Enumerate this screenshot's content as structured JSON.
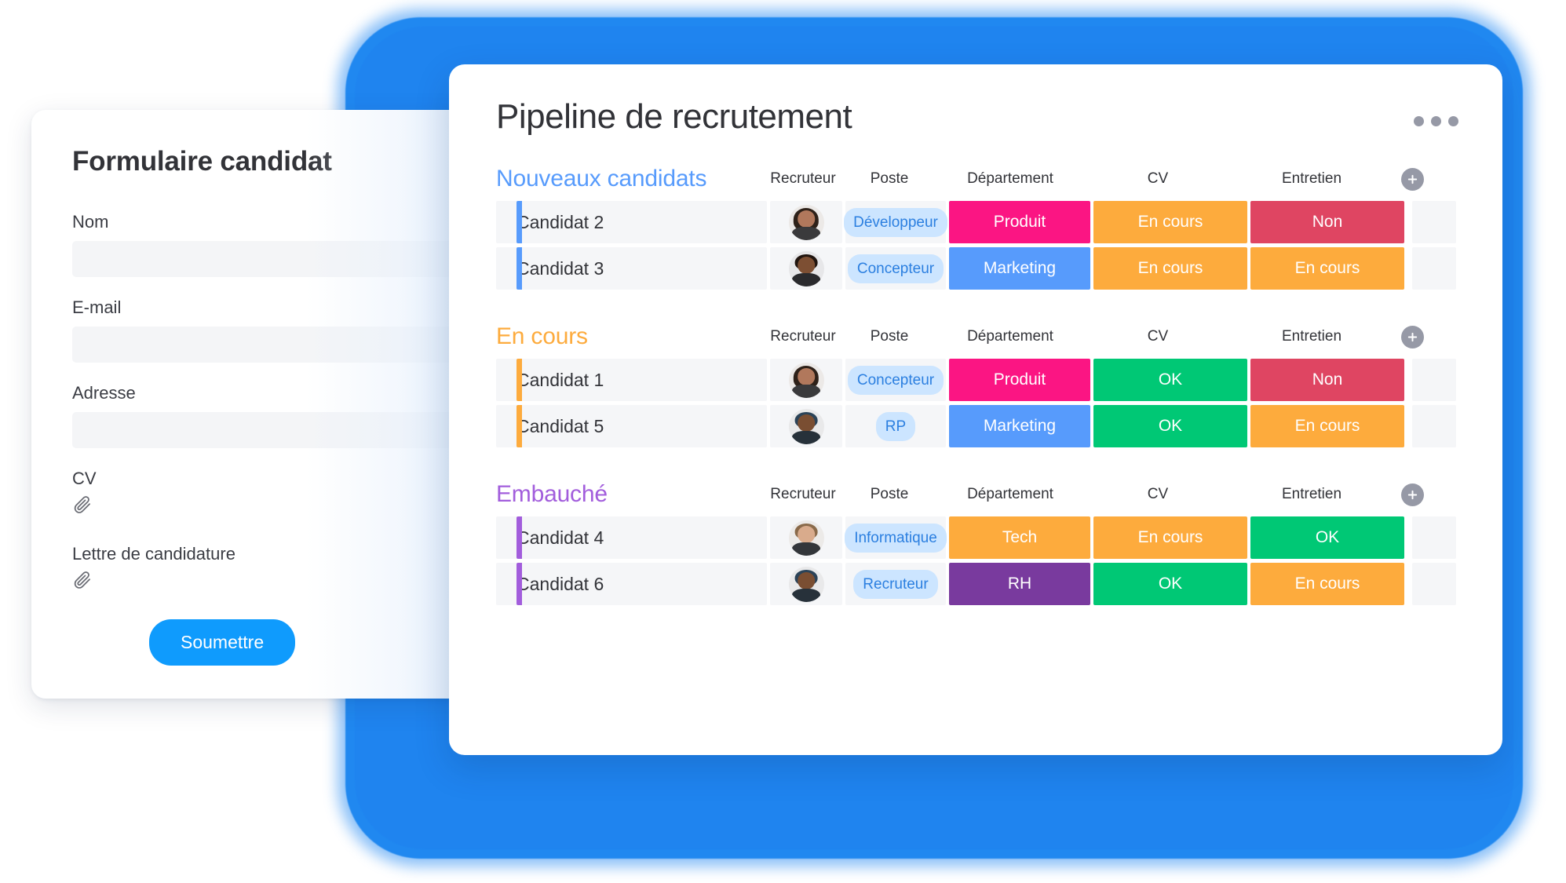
{
  "colors": {
    "glow_blue": "#2088f0",
    "accent_blue": "#579bfc",
    "accent_orange": "#fdab3d",
    "accent_purple": "#a25ddc",
    "pink": "#fb1583",
    "blue": "#579bfc",
    "green": "#00c875",
    "red": "#df4562",
    "orange": "#fdab3d",
    "purple": "#793a9e",
    "tech_orange": "#fdab3d",
    "submit_blue": "#0f9bfd",
    "pill_bg": "#cce5ff",
    "pill_text": "#2b7fe0",
    "cell_grey": "#f5f6f8",
    "text_dark": "#323338",
    "dots_grey": "#9699a6"
  },
  "form": {
    "title": "Formulaire candidat",
    "fields": [
      {
        "label": "Nom",
        "value": "",
        "type": "text"
      },
      {
        "label": "E-mail",
        "value": "",
        "type": "text"
      },
      {
        "label": "Adresse",
        "value": "",
        "type": "text"
      }
    ],
    "file_fields": [
      {
        "label": "CV",
        "icon": "paperclip-icon"
      },
      {
        "label": "Lettre de candidature",
        "icon": "paperclip-icon"
      }
    ],
    "submit_label": "Soumettre"
  },
  "board": {
    "title": "Pipeline de recrutement",
    "menu_icon": "more-options-icon",
    "columns": [
      "Recruteur",
      "Poste",
      "Département",
      "CV",
      "Entretien"
    ],
    "add_column_icon": "plus-icon",
    "groups": [
      {
        "name": "Nouveaux candidats",
        "color": "#579bfc",
        "rows": [
          {
            "name": "Candidat 2",
            "avatar": "avatar-woman-dark-hair",
            "poste": "Développeur",
            "departement": {
              "label": "Produit",
              "color": "#fb1583"
            },
            "cv": {
              "label": "En cours",
              "color": "#fdab3d"
            },
            "entretien": {
              "label": "Non",
              "color": "#df4562"
            }
          },
          {
            "name": "Candidat 3",
            "avatar": "avatar-man-beard",
            "poste": "Concepteur",
            "departement": {
              "label": "Marketing",
              "color": "#579bfc"
            },
            "cv": {
              "label": "En cours",
              "color": "#fdab3d"
            },
            "entretien": {
              "label": "En cours",
              "color": "#fdab3d"
            }
          }
        ]
      },
      {
        "name": "En cours",
        "color": "#fdab3d",
        "rows": [
          {
            "name": "Candidat 1",
            "avatar": "avatar-woman-dark-hair",
            "poste": "Concepteur",
            "departement": {
              "label": "Produit",
              "color": "#fb1583"
            },
            "cv": {
              "label": "OK",
              "color": "#00c875"
            },
            "entretien": {
              "label": "Non",
              "color": "#df4562"
            }
          },
          {
            "name": "Candidat 5",
            "avatar": "avatar-man-cap",
            "poste": "RP",
            "departement": {
              "label": "Marketing",
              "color": "#579bfc"
            },
            "cv": {
              "label": "OK",
              "color": "#00c875"
            },
            "entretien": {
              "label": "En cours",
              "color": "#fdab3d"
            }
          }
        ]
      },
      {
        "name": "Embauché",
        "color": "#a25ddc",
        "rows": [
          {
            "name": "Candidat 4",
            "avatar": "avatar-man-light",
            "poste": "Informatique",
            "departement": {
              "label": "Tech",
              "color": "#fdab3d"
            },
            "cv": {
              "label": "En cours",
              "color": "#fdab3d"
            },
            "entretien": {
              "label": "OK",
              "color": "#00c875"
            }
          },
          {
            "name": "Candidat 6",
            "avatar": "avatar-man-cap",
            "poste": "Recruteur",
            "departement": {
              "label": "RH",
              "color": "#793a9e"
            },
            "cv": {
              "label": "OK",
              "color": "#00c875"
            },
            "entretien": {
              "label": "En cours",
              "color": "#fdab3d"
            }
          }
        ]
      }
    ]
  }
}
